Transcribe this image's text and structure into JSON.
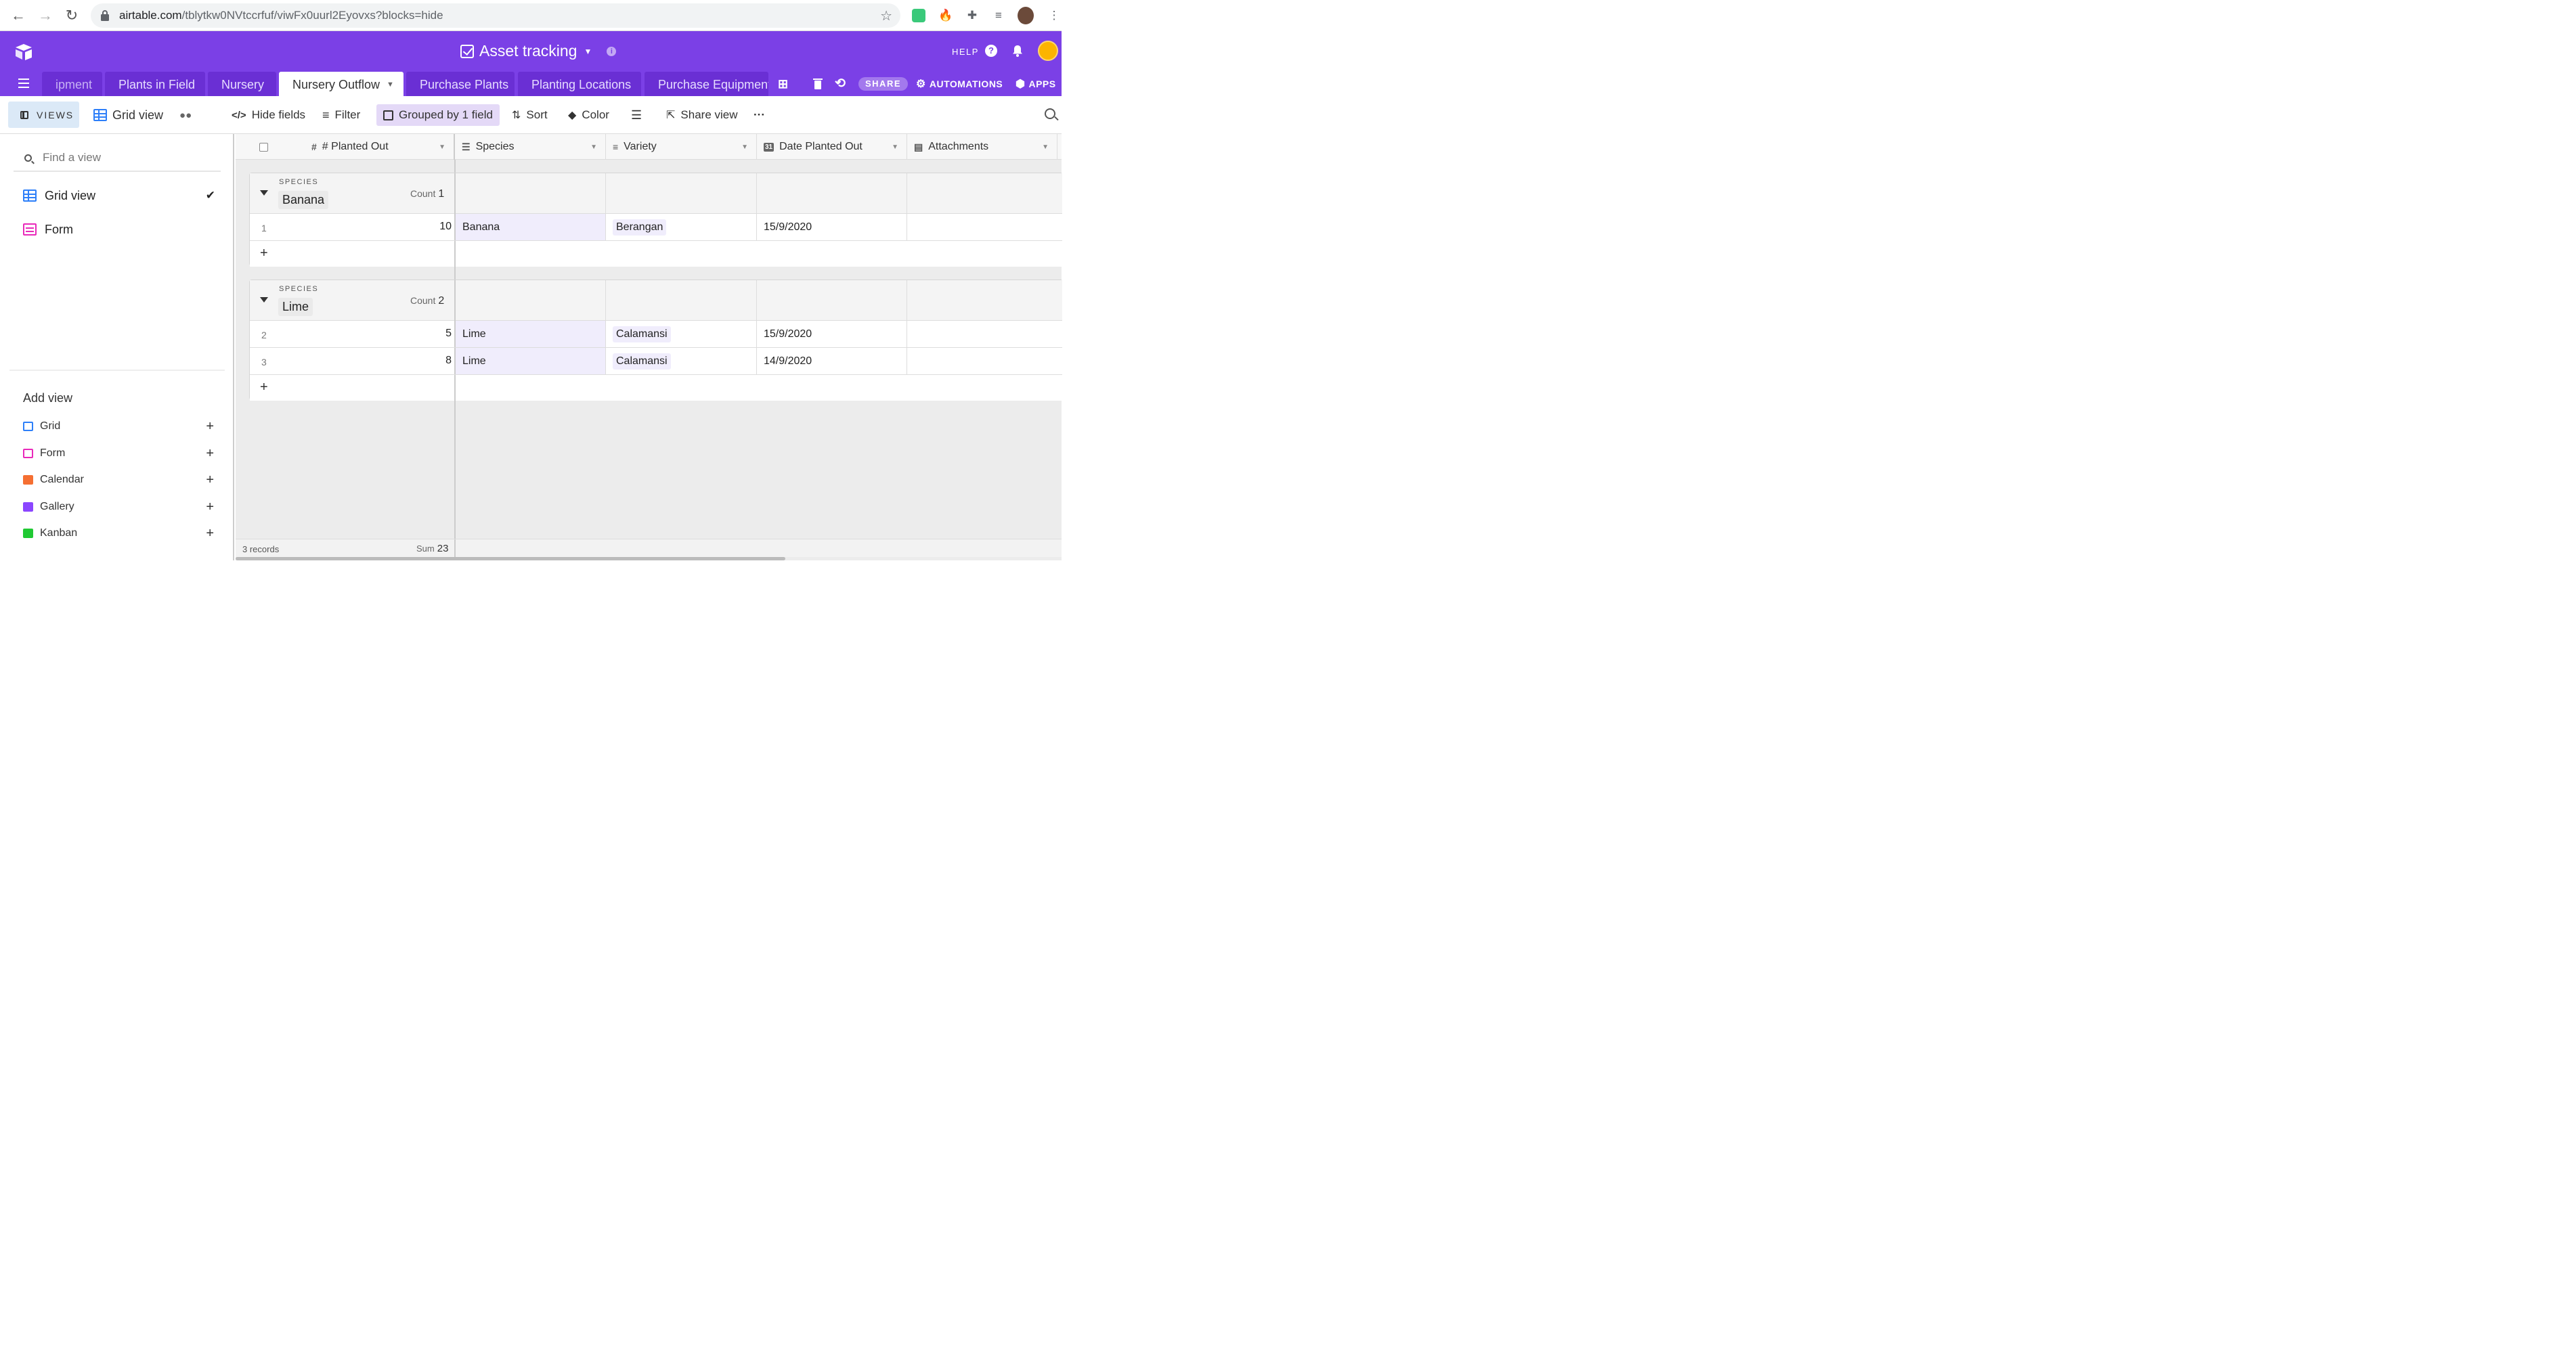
{
  "browser": {
    "url_host": "airtable.com",
    "url_path": "/tblytkw0NVtccrfuf/viwFx0uurl2Eyovxs?blocks=hide"
  },
  "header": {
    "title": "Asset tracking",
    "help": "HELP",
    "brand_color": "#7b40e6"
  },
  "tabs": [
    {
      "label": "ipment"
    },
    {
      "label": "Plants in Field"
    },
    {
      "label": "Nursery"
    },
    {
      "label": "Nursery Outflow"
    },
    {
      "label": "Purchase Plants"
    },
    {
      "label": "Planting Locations"
    },
    {
      "label": "Purchase Equipment"
    }
  ],
  "tab_actions": {
    "share": "SHARE",
    "automations": "AUTOMATIONS",
    "apps": "APPS"
  },
  "toolbar": {
    "views": "VIEWS",
    "view_name": "Grid view",
    "hide_fields": "Hide fields",
    "filter": "Filter",
    "grouped": "Grouped by 1 field",
    "sort": "Sort",
    "color": "Color",
    "share_view": "Share view",
    "more": "···"
  },
  "sidebar": {
    "find_placeholder": "Find a view",
    "views": [
      {
        "label": "Grid view",
        "icon": "grid-icon",
        "selected": true
      },
      {
        "label": "Form",
        "icon": "form-icon",
        "selected": false
      }
    ],
    "add_view_title": "Add view",
    "add_items": [
      {
        "label": "Grid",
        "color": "#2d7ff9"
      },
      {
        "label": "Form",
        "color": "#e929ba"
      },
      {
        "label": "Calendar",
        "color": "#f56f32"
      },
      {
        "label": "Gallery",
        "color": "#8b46ff"
      },
      {
        "label": "Kanban",
        "color": "#20c933"
      }
    ]
  },
  "grid": {
    "columns": [
      "# Planted Out",
      "Species",
      "Variety",
      "Date Planted Out",
      "Attachments"
    ],
    "groups": [
      {
        "field": "SPECIES",
        "value": "Banana",
        "count_label": "Count",
        "count": "1",
        "rows": [
          {
            "num": "1",
            "planted_out": "10",
            "species": "Banana",
            "variety": "Berangan",
            "date": "15/9/2020"
          }
        ]
      },
      {
        "field": "SPECIES",
        "value": "Lime",
        "count_label": "Count",
        "count": "2",
        "rows": [
          {
            "num": "2",
            "planted_out": "5",
            "species": "Lime",
            "variety": "Calamansi",
            "date": "15/9/2020"
          },
          {
            "num": "3",
            "planted_out": "8",
            "species": "Lime",
            "variety": "Calamansi",
            "date": "14/9/2020"
          }
        ]
      }
    ],
    "footer": {
      "records": "3 records",
      "sum_label": "Sum",
      "sum": "23"
    }
  }
}
